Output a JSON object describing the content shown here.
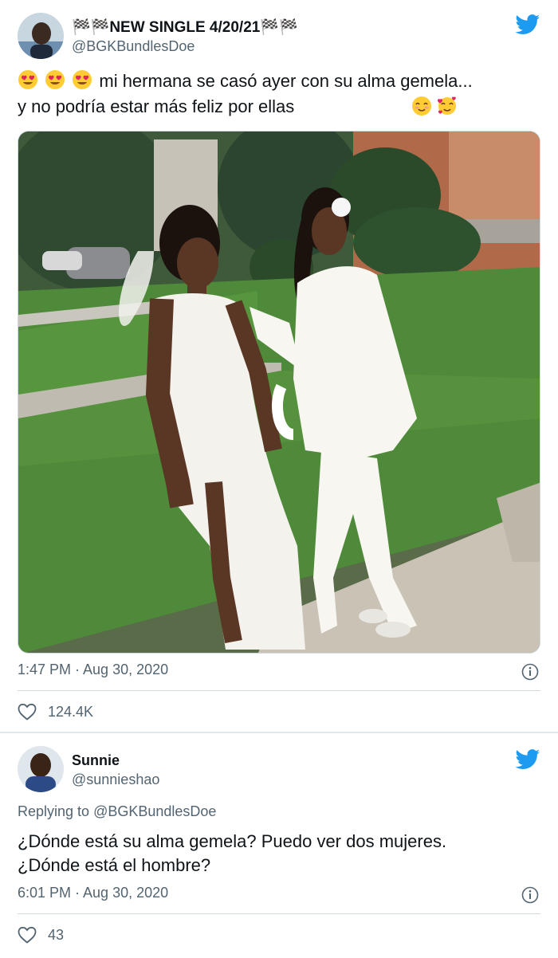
{
  "tweet_main": {
    "display_name": "🏁🏁NEW SINGLE 4/20/21🏁🏁",
    "handle": "@BGKBundlesDoe",
    "text_line1": "mi hermana se casó ayer con su alma gemela...",
    "text_line2": "y no podría estar más feliz por ellas",
    "timestamp": "1:47 PM · Aug 30, 2020",
    "likes": "124.4K"
  },
  "tweet_reply": {
    "display_name": "Sunnie",
    "handle": "@sunnieshao",
    "replying_to_label": "Replying to",
    "replying_to_handle": "@BGKBundlesDoe",
    "text_line1": "¿Dónde está su alma gemela? Puedo ver dos mujeres.",
    "text_line2": "¿Dónde está el hombre?",
    "timestamp": "6:01 PM · Aug 30, 2020",
    "likes": "43"
  },
  "colors": {
    "twitter_blue": "#1d9bf0",
    "secondary_text": "#536471",
    "primary_text": "#0f1419",
    "divider": "#cfd9de"
  },
  "icons": {
    "brand": "twitter-bird-icon",
    "info": "info-icon",
    "like": "heart-icon",
    "emoji_line1": "heart-eyes-emoji",
    "emoji_line2": [
      "smiling-blush-emoji",
      "smiling-hearts-emoji"
    ]
  }
}
